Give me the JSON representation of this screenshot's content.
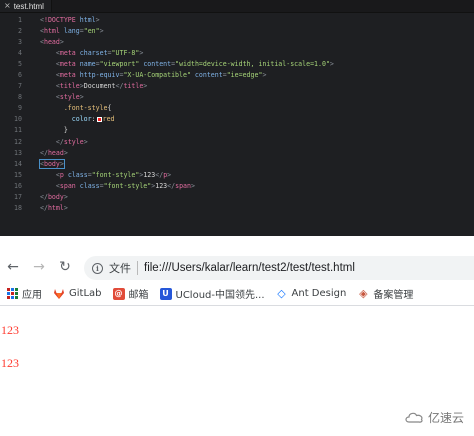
{
  "editor": {
    "tab": {
      "close_glyph": "×",
      "label": "test.html"
    },
    "lines": [
      {
        "n": "1",
        "indent": "",
        "parts": [
          [
            "t",
            "<"
          ],
          [
            "tag",
            "!DOCTYPE"
          ],
          [
            "plain",
            " "
          ],
          [
            "attr",
            "html"
          ],
          [
            "t",
            ">"
          ]
        ]
      },
      {
        "n": "2",
        "indent": "",
        "parts": [
          [
            "t",
            "<"
          ],
          [
            "tag",
            "html"
          ],
          [
            "plain",
            " "
          ],
          [
            "attr",
            "lang"
          ],
          [
            "t",
            "="
          ],
          [
            "str",
            "\"en\""
          ],
          [
            "t",
            ">"
          ]
        ]
      },
      {
        "n": "3",
        "indent": "",
        "parts": [
          [
            "t",
            "<"
          ],
          [
            "tag",
            "head"
          ],
          [
            "t",
            ">"
          ]
        ]
      },
      {
        "n": "4",
        "indent": "    ",
        "parts": [
          [
            "t",
            "<"
          ],
          [
            "tag",
            "meta"
          ],
          [
            "plain",
            " "
          ],
          [
            "attr",
            "charset"
          ],
          [
            "t",
            "="
          ],
          [
            "str",
            "\"UTF-8\""
          ],
          [
            "t",
            ">"
          ]
        ]
      },
      {
        "n": "5",
        "indent": "    ",
        "parts": [
          [
            "t",
            "<"
          ],
          [
            "tag",
            "meta"
          ],
          [
            "plain",
            " "
          ],
          [
            "attr",
            "name"
          ],
          [
            "t",
            "="
          ],
          [
            "str",
            "\"viewport\""
          ],
          [
            "plain",
            " "
          ],
          [
            "attr",
            "content"
          ],
          [
            "t",
            "="
          ],
          [
            "str",
            "\"width=device-width, initial-scale=1.0\""
          ],
          [
            "t",
            ">"
          ]
        ]
      },
      {
        "n": "6",
        "indent": "    ",
        "parts": [
          [
            "t",
            "<"
          ],
          [
            "tag",
            "meta"
          ],
          [
            "plain",
            " "
          ],
          [
            "attr",
            "http-equiv"
          ],
          [
            "t",
            "="
          ],
          [
            "str",
            "\"X-UA-Compatible\""
          ],
          [
            "plain",
            " "
          ],
          [
            "attr",
            "content"
          ],
          [
            "t",
            "="
          ],
          [
            "str",
            "\"ie=edge\""
          ],
          [
            "t",
            ">"
          ]
        ]
      },
      {
        "n": "7",
        "indent": "    ",
        "parts": [
          [
            "t",
            "<"
          ],
          [
            "tag",
            "title"
          ],
          [
            "t",
            ">"
          ],
          [
            "plain",
            "Document"
          ],
          [
            "t",
            "</"
          ],
          [
            "tag",
            "title"
          ],
          [
            "t",
            ">"
          ]
        ]
      },
      {
        "n": "8",
        "indent": "    ",
        "parts": [
          [
            "t",
            "<"
          ],
          [
            "tag",
            "style"
          ],
          [
            "t",
            ">"
          ]
        ]
      },
      {
        "n": "9",
        "indent": "      ",
        "parts": [
          [
            "sel",
            ".font-style"
          ],
          [
            "plain",
            "{"
          ]
        ]
      },
      {
        "n": "10",
        "indent": "        ",
        "parts": [
          [
            "prop",
            "color"
          ],
          [
            "plain",
            ":"
          ],
          [
            "swatch",
            ""
          ],
          [
            "sel",
            "red"
          ]
        ]
      },
      {
        "n": "11",
        "indent": "      ",
        "parts": [
          [
            "plain",
            "}"
          ]
        ]
      },
      {
        "n": "12",
        "indent": "    ",
        "parts": [
          [
            "t",
            "</"
          ],
          [
            "tag",
            "style"
          ],
          [
            "t",
            ">"
          ]
        ]
      },
      {
        "n": "13",
        "indent": "",
        "parts": [
          [
            "t",
            "</"
          ],
          [
            "tag",
            "head"
          ],
          [
            "t",
            ">"
          ]
        ]
      },
      {
        "n": "14",
        "indent": "",
        "parts": [
          [
            "hlt",
            "<"
          ],
          [
            "hltag",
            "body"
          ],
          [
            "hlt",
            ">"
          ]
        ]
      },
      {
        "n": "15",
        "indent": "    ",
        "parts": [
          [
            "t",
            "<"
          ],
          [
            "tag",
            "p"
          ],
          [
            "plain",
            " "
          ],
          [
            "attr",
            "class"
          ],
          [
            "t",
            "="
          ],
          [
            "str",
            "\"font-style\""
          ],
          [
            "t",
            ">"
          ],
          [
            "plain",
            "123"
          ],
          [
            "t",
            "</"
          ],
          [
            "tag",
            "p"
          ],
          [
            "t",
            ">"
          ]
        ]
      },
      {
        "n": "16",
        "indent": "    ",
        "parts": [
          [
            "t",
            "<"
          ],
          [
            "tag",
            "span"
          ],
          [
            "plain",
            " "
          ],
          [
            "attr",
            "class"
          ],
          [
            "t",
            "="
          ],
          [
            "str",
            "\"font-style\""
          ],
          [
            "t",
            ">"
          ],
          [
            "plain",
            "123"
          ],
          [
            "t",
            "</"
          ],
          [
            "tag",
            "span"
          ],
          [
            "t",
            ">"
          ]
        ]
      },
      {
        "n": "17",
        "indent": "",
        "parts": [
          [
            "t",
            "</"
          ],
          [
            "tag",
            "body"
          ],
          [
            "t",
            ">"
          ]
        ]
      },
      {
        "n": "18",
        "indent": "",
        "parts": [
          [
            "t",
            "</"
          ],
          [
            "tag",
            "html"
          ],
          [
            "t",
            ">"
          ]
        ]
      }
    ]
  },
  "browser": {
    "back_glyph": "←",
    "forward_glyph": "→",
    "reload_glyph": "↻",
    "info_glyph": "i",
    "scheme_label": "文件",
    "url": "file:///Users/kalar/learn/test2/test/test.html",
    "bookmarks": [
      {
        "name": "apps",
        "label": "应用"
      },
      {
        "name": "gitlab",
        "label": "GitLab"
      },
      {
        "name": "mail",
        "label": "邮箱",
        "glyph": "@"
      },
      {
        "name": "ucloud",
        "label": "UCloud-中国领先...",
        "glyph": "U"
      },
      {
        "name": "ant-design",
        "label": "Ant Design",
        "glyph": "◇"
      },
      {
        "name": "beian",
        "label": "备案管理",
        "glyph": "◈"
      }
    ]
  },
  "page": {
    "p_text": "123",
    "span_text": "123"
  },
  "watermark": {
    "text": "亿速云"
  },
  "colors": {
    "editor_bg": "#1e1f22",
    "tag": "#e06c9f",
    "attr": "#7fb2e6",
    "string": "#a6d478",
    "output_red": "#ff3b30"
  }
}
